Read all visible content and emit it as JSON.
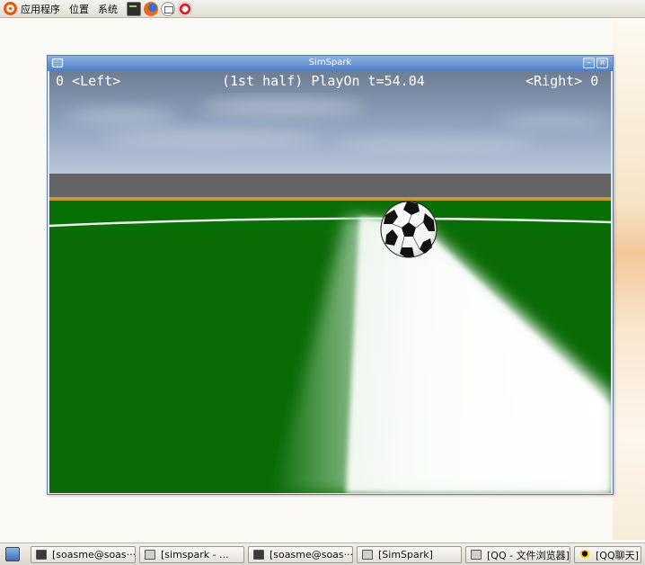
{
  "top_panel": {
    "menus": [
      "应用程序",
      "位置",
      "系统"
    ],
    "launchers": [
      "terminal-icon",
      "firefox-icon",
      "mail-icon",
      "help-icon"
    ]
  },
  "window": {
    "title": "SimSpark",
    "hud": {
      "left": "0 <Left>",
      "center": "(1st half) PlayOn t=54.04",
      "right": "<Right> 0"
    }
  },
  "taskbar": {
    "tasks": [
      {
        "label": "[soasme@soas···",
        "icon": "terminal-icon"
      },
      {
        "label": "[simspark - ...",
        "icon": "text-editor-icon"
      },
      {
        "label": "[soasme@soas···",
        "icon": "terminal-icon"
      },
      {
        "label": "[SimSpark]",
        "icon": "window-icon"
      },
      {
        "label": "[QQ - 文件浏览器]",
        "icon": "file-browser-icon"
      },
      {
        "label": "[QQ聊天]",
        "icon": "qq-penguin-icon"
      }
    ]
  },
  "colors": {
    "pitch_green": "#086e06",
    "titlebar_blue": "#4f7ec4",
    "hud_text": "#ffffff"
  }
}
